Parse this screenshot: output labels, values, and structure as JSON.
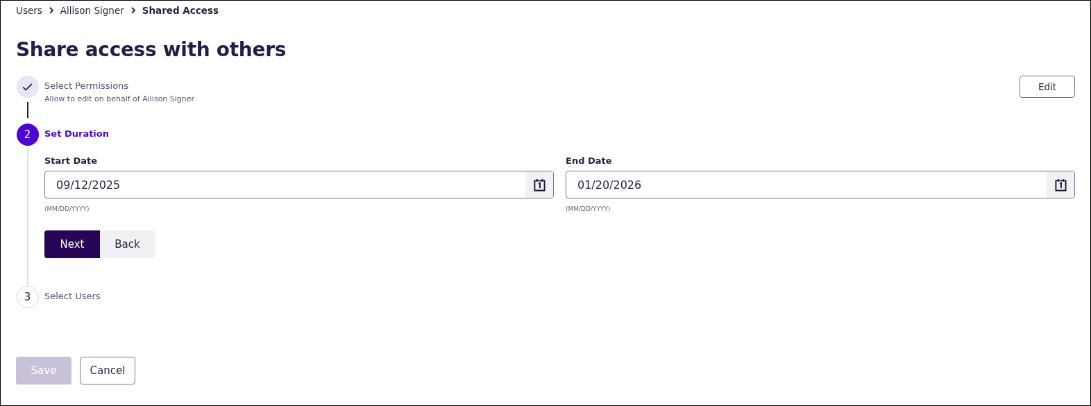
{
  "breadcrumb": [
    {
      "label": "Users",
      "current": false
    },
    {
      "label": "Allison Signer",
      "current": false
    },
    {
      "label": "Shared Access",
      "current": true
    }
  ],
  "title": "Share access with others",
  "steps": [
    {
      "kind": "done",
      "label": "Select Permissions",
      "summary": "Allow to edit on behalf of Allison Signer",
      "action": "Edit"
    },
    {
      "kind": "active",
      "marker": "2",
      "label": "Set Duration",
      "fields": [
        {
          "label": "Start Date",
          "value": "09/12/2025",
          "hint": "(MM/DD/YYYY)"
        },
        {
          "label": "End Date",
          "value": "01/20/2026",
          "hint": "(MM/DD/YYYY)"
        }
      ],
      "buttons": [
        {
          "label": "Next",
          "kind": "primary"
        },
        {
          "label": "Back",
          "kind": "secondary"
        }
      ]
    },
    {
      "kind": "pending",
      "marker": "3",
      "label": "Select Users"
    }
  ],
  "footer": [
    {
      "label": "Save",
      "kind": "primary",
      "disabled": true
    },
    {
      "label": "Cancel",
      "kind": "outline",
      "disabled": false
    }
  ]
}
